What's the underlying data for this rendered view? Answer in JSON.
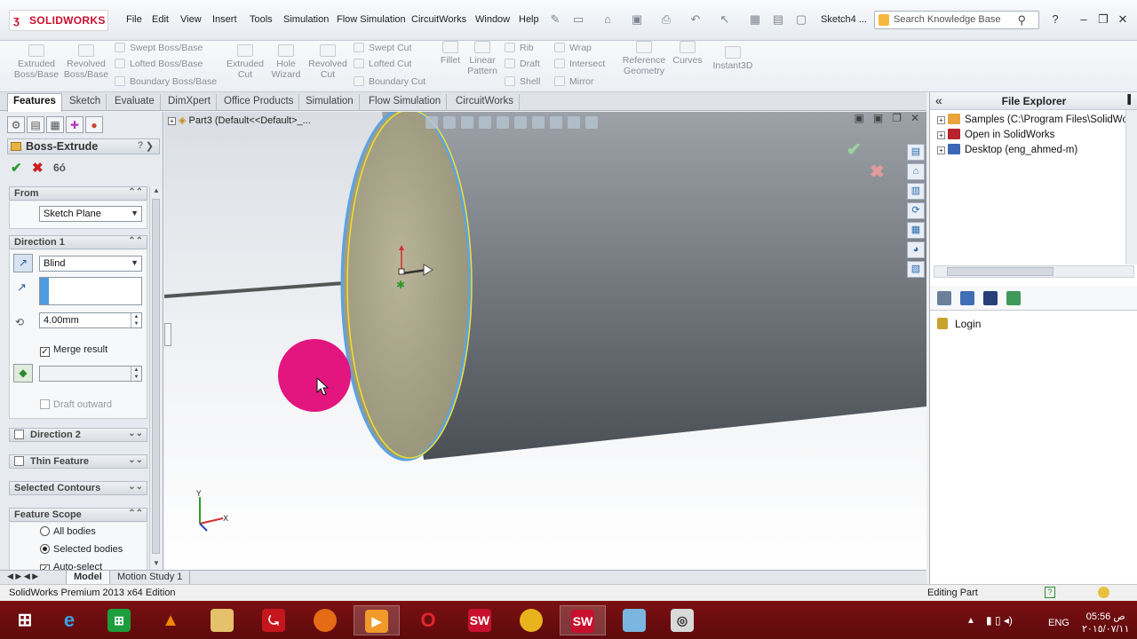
{
  "app": {
    "logo_text": "SOLIDWORKS",
    "document_title": "Sketch4 ...",
    "edition": "SolidWorks Premium 2013 x64 Edition"
  },
  "menu": [
    "File",
    "Edit",
    "View",
    "Insert",
    "Tools",
    "Simulation",
    "Flow Simulation",
    "CircuitWorks",
    "Window",
    "Help"
  ],
  "search": {
    "placeholder": "Search Knowledge Base"
  },
  "ribbon": {
    "extruded_boss": [
      "Extruded",
      "Boss/Base"
    ],
    "revolved_boss": [
      "Revolved",
      "Boss/Base"
    ],
    "swept_boss": "Swept Boss/Base",
    "lofted_boss": "Lofted Boss/Base",
    "boundary_boss": "Boundary Boss/Base",
    "extruded_cut": [
      "Extruded",
      "Cut"
    ],
    "hole_wizard": [
      "Hole",
      "Wizard"
    ],
    "revolved_cut": [
      "Revolved",
      "Cut"
    ],
    "swept_cut": "Swept Cut",
    "lofted_cut": "Lofted Cut",
    "boundary_cut": "Boundary Cut",
    "fillet": "Fillet",
    "linear_pattern": [
      "Linear",
      "Pattern"
    ],
    "rib": "Rib",
    "draft": "Draft",
    "shell": "Shell",
    "wrap": "Wrap",
    "intersect": "Intersect",
    "mirror": "Mirror",
    "reference_geometry": [
      "Reference",
      "Geometry"
    ],
    "curves": "Curves",
    "instant3d": "Instant3D"
  },
  "tabs": [
    "Features",
    "Sketch",
    "Evaluate",
    "DimXpert",
    "Office Products",
    "Simulation",
    "Flow Simulation",
    "CircuitWorks"
  ],
  "property_manager": {
    "title": "Boss-Extrude",
    "help": "?",
    "from": {
      "label": "From",
      "value": "Sketch Plane"
    },
    "direction1": {
      "label": "Direction 1",
      "end_condition": "Blind",
      "depth": "4.00mm",
      "merge_result": "Merge result",
      "draft_outward": "Draft outward"
    },
    "direction2": "Direction 2",
    "thin_feature": "Thin Feature",
    "selected_contours": "Selected Contours",
    "feature_scope": {
      "label": "Feature Scope",
      "all_bodies": "All bodies",
      "selected_bodies": "Selected bodies",
      "auto_select": "Auto-select"
    }
  },
  "viewport": {
    "tree_root": "Part3  (Default<<Default>_..."
  },
  "file_explorer": {
    "title": "File Explorer",
    "items": [
      "Samples (C:\\Program Files\\SolidWork",
      "Open in SolidWorks",
      "Desktop (eng_ahmed-m)"
    ],
    "login": "Login"
  },
  "model_tabs": [
    "Model",
    "Motion Study 1"
  ],
  "status": {
    "mode": "Editing Part",
    "help": "?"
  },
  "taskbar": {
    "language": "ENG",
    "time": "05:56 ص",
    "date": "٢٠١٥/٠٧/١١"
  },
  "colors": {
    "accent_pink": "#e3157f",
    "cylinder_face": "#a7a387",
    "taskbar": "#6e0d0f"
  }
}
